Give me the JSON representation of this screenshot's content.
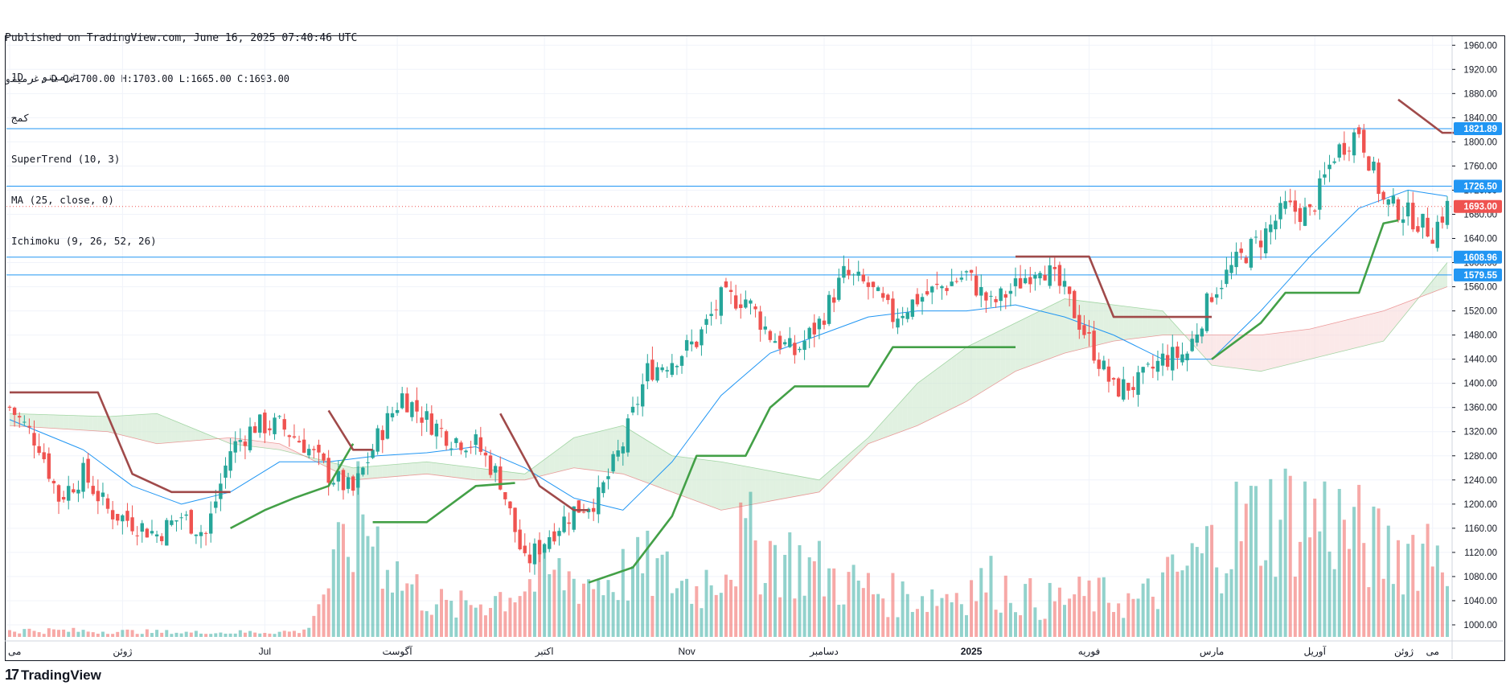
{
  "header": {
    "published": "Published on TradingView.com, June 16, 2025 07:40:46 UTC",
    "ohlc_line": "غرمينو, D O:1700.00 H:1703.00 L:1665.00 C:1693.00"
  },
  "legend": {
    "symbol_line": "1D , غرمينو",
    "sub_line": "کمج",
    "indicators": [
      "SuperTrend (10, 3)",
      "MA (25, close, 0)",
      "Ichimoku (9, 26, 52, 26)"
    ]
  },
  "brand": {
    "logo": "17",
    "name": "TradingView"
  },
  "colors": {
    "up": "#26a69a",
    "down": "#ef5350",
    "supertrend_up": "#43a047",
    "supertrend_down": "#a04a4a",
    "ma": "#2196f3",
    "cloud_up": "#c8e6c9",
    "cloud_down": "#f8d7d7",
    "hline": "#2196f3",
    "last": "#ef5350"
  },
  "chart_data": {
    "type": "candlestick",
    "ylim": [
      980,
      1975
    ],
    "y_ticks": [
      1000,
      1040,
      1080,
      1120,
      1160,
      1200,
      1240,
      1280,
      1320,
      1360,
      1400,
      1440,
      1480,
      1520,
      1560,
      1600,
      1640,
      1680,
      1720,
      1760,
      1800,
      1840,
      1880,
      1920,
      1960
    ],
    "x_ticks": [
      "می",
      "ژوئن",
      "Jul",
      "آگوست",
      "اکتبر",
      "Nov",
      "دسامبر",
      "2025",
      "فوریه",
      "مارس",
      "آوریل",
      "می",
      "ژوئن"
    ],
    "horizontal_levels": [
      {
        "value": 1821.89,
        "label": "1821.89"
      },
      {
        "value": 1726.5,
        "label": "1726.50"
      },
      {
        "value": 1608.96,
        "label": "1608.96"
      },
      {
        "value": 1579.55,
        "label": "1579.55"
      }
    ],
    "last_price": {
      "value": 1693.0,
      "label": "1693.00"
    },
    "closes_anchor": [
      [
        0,
        1360
      ],
      [
        6,
        1300
      ],
      [
        10,
        1210
      ],
      [
        15,
        1250
      ],
      [
        20,
        1190
      ],
      [
        25,
        1170
      ],
      [
        30,
        1150
      ],
      [
        35,
        1180
      ],
      [
        40,
        1150
      ],
      [
        45,
        1290
      ],
      [
        50,
        1330
      ],
      [
        55,
        1330
      ],
      [
        60,
        1300
      ],
      [
        65,
        1250
      ],
      [
        70,
        1220
      ],
      [
        75,
        1310
      ],
      [
        80,
        1380
      ],
      [
        85,
        1340
      ],
      [
        90,
        1310
      ],
      [
        95,
        1300
      ],
      [
        100,
        1240
      ],
      [
        105,
        1100
      ],
      [
        110,
        1150
      ],
      [
        115,
        1190
      ],
      [
        120,
        1210
      ],
      [
        125,
        1300
      ],
      [
        130,
        1420
      ],
      [
        135,
        1440
      ],
      [
        140,
        1470
      ],
      [
        145,
        1540
      ],
      [
        150,
        1540
      ],
      [
        155,
        1480
      ],
      [
        160,
        1450
      ],
      [
        165,
        1500
      ],
      [
        170,
        1580
      ],
      [
        175,
        1560
      ],
      [
        180,
        1510
      ],
      [
        185,
        1540
      ],
      [
        190,
        1560
      ],
      [
        195,
        1580
      ],
      [
        200,
        1530
      ],
      [
        205,
        1560
      ],
      [
        210,
        1600
      ],
      [
        215,
        1550
      ],
      [
        220,
        1470
      ],
      [
        225,
        1390
      ],
      [
        230,
        1400
      ],
      [
        235,
        1440
      ],
      [
        240,
        1450
      ],
      [
        245,
        1550
      ],
      [
        250,
        1600
      ],
      [
        255,
        1640
      ],
      [
        260,
        1690
      ],
      [
        265,
        1680
      ],
      [
        270,
        1780
      ],
      [
        275,
        1820
      ],
      [
        280,
        1700
      ],
      [
        285,
        1680
      ],
      [
        290,
        1650
      ],
      [
        293,
        1693
      ]
    ],
    "ma_anchor": [
      [
        0,
        1340
      ],
      [
        15,
        1290
      ],
      [
        25,
        1230
      ],
      [
        35,
        1200
      ],
      [
        45,
        1220
      ],
      [
        55,
        1270
      ],
      [
        65,
        1270
      ],
      [
        75,
        1280
      ],
      [
        85,
        1285
      ],
      [
        95,
        1295
      ],
      [
        105,
        1260
      ],
      [
        115,
        1210
      ],
      [
        125,
        1190
      ],
      [
        135,
        1270
      ],
      [
        145,
        1380
      ],
      [
        155,
        1450
      ],
      [
        165,
        1480
      ],
      [
        175,
        1510
      ],
      [
        185,
        1520
      ],
      [
        195,
        1520
      ],
      [
        205,
        1530
      ],
      [
        215,
        1510
      ],
      [
        225,
        1480
      ],
      [
        235,
        1440
      ],
      [
        245,
        1440
      ],
      [
        255,
        1520
      ],
      [
        265,
        1610
      ],
      [
        275,
        1690
      ],
      [
        285,
        1720
      ],
      [
        293,
        1710
      ]
    ],
    "supertrend": [
      {
        "dir": "down",
        "points": [
          [
            0,
            1385
          ],
          [
            18,
            1385
          ],
          [
            25,
            1250
          ],
          [
            33,
            1220
          ],
          [
            45,
            1220
          ]
        ]
      },
      {
        "dir": "up",
        "points": [
          [
            45,
            1160
          ],
          [
            52,
            1190
          ],
          [
            58,
            1210
          ],
          [
            65,
            1230
          ],
          [
            70,
            1300
          ]
        ]
      },
      {
        "dir": "down",
        "points": [
          [
            65,
            1355
          ],
          [
            70,
            1290
          ],
          [
            74,
            1290
          ]
        ]
      },
      {
        "dir": "up",
        "points": [
          [
            74,
            1170
          ],
          [
            85,
            1170
          ],
          [
            95,
            1230
          ],
          [
            103,
            1235
          ]
        ]
      },
      {
        "dir": "down",
        "points": [
          [
            100,
            1350
          ],
          [
            108,
            1230
          ],
          [
            115,
            1190
          ],
          [
            118,
            1190
          ]
        ]
      },
      {
        "dir": "up",
        "points": [
          [
            118,
            1070
          ],
          [
            127,
            1095
          ],
          [
            135,
            1180
          ],
          [
            140,
            1280
          ],
          [
            150,
            1280
          ],
          [
            155,
            1360
          ],
          [
            160,
            1395
          ],
          [
            175,
            1395
          ],
          [
            180,
            1460
          ],
          [
            205,
            1460
          ]
        ]
      },
      {
        "dir": "down",
        "points": [
          [
            205,
            1610
          ],
          [
            220,
            1610
          ],
          [
            225,
            1510
          ],
          [
            245,
            1510
          ]
        ]
      },
      {
        "dir": "up",
        "points": [
          [
            245,
            1440
          ],
          [
            255,
            1500
          ],
          [
            260,
            1550
          ],
          [
            275,
            1550
          ],
          [
            280,
            1665
          ],
          [
            283,
            1670
          ]
        ]
      },
      {
        "dir": "down",
        "points": [
          [
            283,
            1870
          ],
          [
            292,
            1815
          ],
          [
            295,
            1815
          ]
        ]
      }
    ],
    "cloud": {
      "a_anchor": [
        [
          0,
          1350
        ],
        [
          20,
          1345
        ],
        [
          30,
          1350
        ],
        [
          45,
          1300
        ],
        [
          55,
          1290
        ],
        [
          70,
          1260
        ],
        [
          85,
          1270
        ],
        [
          95,
          1260
        ],
        [
          105,
          1250
        ],
        [
          115,
          1310
        ],
        [
          125,
          1330
        ],
        [
          135,
          1280
        ],
        [
          145,
          1270
        ],
        [
          165,
          1240
        ],
        [
          175,
          1310
        ],
        [
          185,
          1400
        ],
        [
          195,
          1460
        ],
        [
          205,
          1500
        ],
        [
          215,
          1540
        ],
        [
          225,
          1530
        ],
        [
          235,
          1520
        ],
        [
          245,
          1430
        ],
        [
          255,
          1420
        ],
        [
          265,
          1440
        ],
        [
          280,
          1470
        ],
        [
          293,
          1600
        ]
      ],
      "b_anchor": [
        [
          0,
          1330
        ],
        [
          20,
          1320
        ],
        [
          30,
          1300
        ],
        [
          45,
          1310
        ],
        [
          55,
          1300
        ],
        [
          70,
          1240
        ],
        [
          85,
          1250
        ],
        [
          95,
          1240
        ],
        [
          105,
          1240
        ],
        [
          115,
          1260
        ],
        [
          125,
          1250
        ],
        [
          135,
          1220
        ],
        [
          145,
          1190
        ],
        [
          165,
          1220
        ],
        [
          175,
          1300
        ],
        [
          185,
          1330
        ],
        [
          195,
          1370
        ],
        [
          205,
          1420
        ],
        [
          215,
          1450
        ],
        [
          225,
          1470
        ],
        [
          235,
          1480
        ],
        [
          245,
          1480
        ],
        [
          255,
          1480
        ],
        [
          265,
          1490
        ],
        [
          280,
          1520
        ],
        [
          293,
          1560
        ]
      ]
    },
    "volume_anchor": [
      [
        0,
        5
      ],
      [
        40,
        3
      ],
      [
        60,
        4
      ],
      [
        72,
        90
      ],
      [
        80,
        40
      ],
      [
        90,
        20
      ],
      [
        100,
        30
      ],
      [
        110,
        45
      ],
      [
        120,
        40
      ],
      [
        130,
        50
      ],
      [
        140,
        35
      ],
      [
        150,
        70
      ],
      [
        160,
        55
      ],
      [
        170,
        40
      ],
      [
        180,
        30
      ],
      [
        190,
        30
      ],
      [
        200,
        40
      ],
      [
        210,
        25
      ],
      [
        220,
        30
      ],
      [
        230,
        25
      ],
      [
        240,
        50
      ],
      [
        250,
        80
      ],
      [
        260,
        90
      ],
      [
        270,
        85
      ],
      [
        280,
        60
      ],
      [
        290,
        70
      ]
    ]
  }
}
